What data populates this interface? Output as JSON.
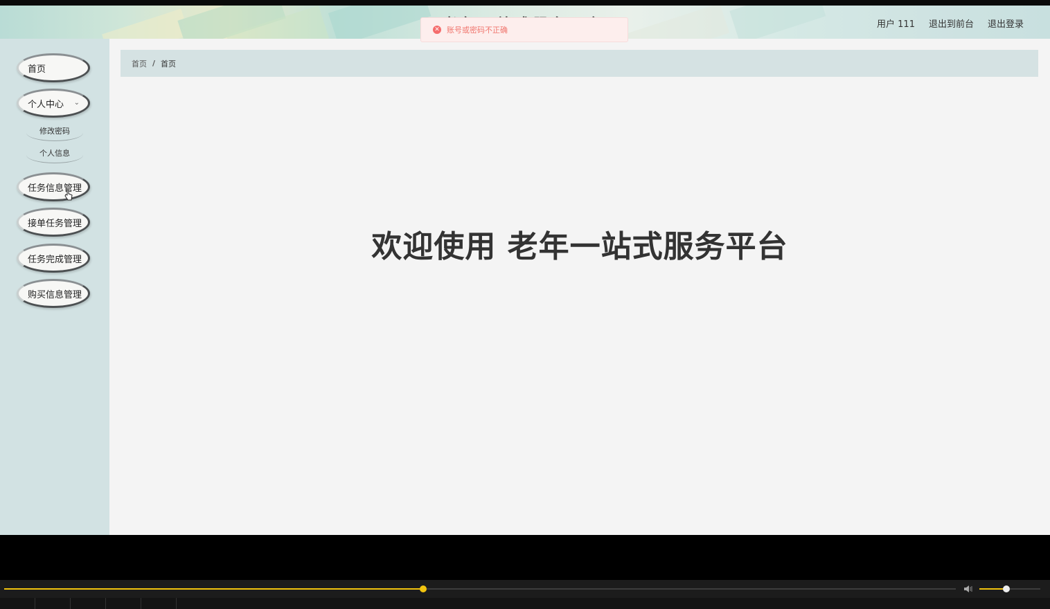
{
  "header": {
    "site_title": "老年一站式服务平台",
    "user_label": "用户 111",
    "back_to_front": "退出到前台",
    "logout": "退出登录"
  },
  "toast": {
    "message": "账号或密码不正确",
    "icon": "error-circle-icon"
  },
  "sidebar": {
    "items": [
      {
        "label": "首页"
      },
      {
        "label": "个人中心",
        "expanded": true,
        "children": [
          {
            "label": "修改密码"
          },
          {
            "label": "个人信息"
          }
        ]
      },
      {
        "label": "任务信息管理"
      },
      {
        "label": "接单任务管理"
      },
      {
        "label": "任务完成管理"
      },
      {
        "label": "购买信息管理"
      }
    ]
  },
  "breadcrumb": {
    "items": [
      "首页",
      "首页"
    ],
    "separator": "/"
  },
  "main": {
    "welcome": "欢迎使用 老年一站式服务平台"
  },
  "player": {
    "progress": 0.44,
    "volume": 0.45,
    "accent_color": "#f2c40f"
  }
}
